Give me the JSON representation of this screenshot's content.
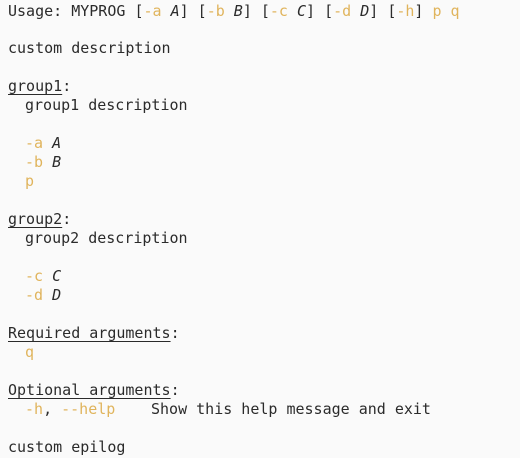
{
  "usage": {
    "prefix": "Usage:",
    "prog": "MYPROG",
    "open": "[",
    "close": "]",
    "opt_a": "-a",
    "meta_a": "A",
    "opt_b": "-b",
    "meta_b": "B",
    "opt_c": "-c",
    "meta_c": "C",
    "opt_d": "-d",
    "meta_d": "D",
    "opt_h": "-h",
    "pos_p": "p",
    "pos_q": "q"
  },
  "description": "custom description",
  "group1": {
    "title": "group1",
    "colon": ":",
    "description": "group1 description",
    "args": [
      {
        "flag": "-a",
        "meta": "A"
      },
      {
        "flag": "-b",
        "meta": "B"
      },
      {
        "flag": "p",
        "meta": ""
      }
    ]
  },
  "group2": {
    "title": "group2",
    "colon": ":",
    "description": "group2 description",
    "args": [
      {
        "flag": "-c",
        "meta": "C"
      },
      {
        "flag": "-d",
        "meta": "D"
      }
    ]
  },
  "required": {
    "title": "Required arguments",
    "colon": ":",
    "args": [
      {
        "flag": "q"
      }
    ]
  },
  "optional": {
    "title": "Optional arguments",
    "colon": ":",
    "help_short": "-h",
    "comma": ",",
    "help_long": "--help",
    "help_text": "Show this help message and exit"
  },
  "epilog": "custom epilog"
}
